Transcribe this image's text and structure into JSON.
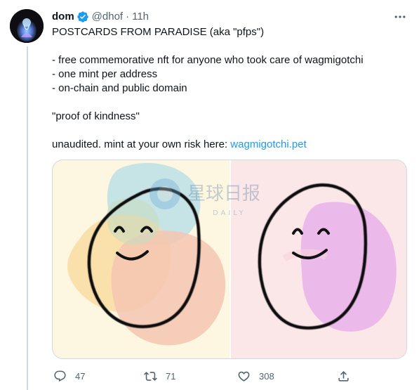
{
  "tweet": {
    "author": {
      "display_name": "dom",
      "handle": "@dhof",
      "verified": true
    },
    "separator": "·",
    "time": "11h",
    "lines": [
      "POSTCARDS FROM PARADISE (aka \"pfps\")",
      "",
      "- free commemorative nft for anyone who took care of wagmigotchi",
      "- one mint per address",
      "- on-chain and public domain",
      "",
      "\"proof of kindness\"",
      ""
    ],
    "last_line_prefix": "unaudited. mint at your own risk here: ",
    "link_text": "wagmigotchi.pet",
    "media": {
      "watermark_cn": "星球日报",
      "watermark_en": "DAILY"
    },
    "actions": {
      "replies": "47",
      "retweets": "71",
      "likes": "308"
    }
  },
  "icons": {
    "more": "more-dots-icon",
    "verified": "verified-badge-icon",
    "reply": "reply-icon",
    "retweet": "retweet-icon",
    "like": "heart-icon",
    "share": "share-icon"
  },
  "colors": {
    "link": "#1d9bf0",
    "secondary_text": "#536471",
    "verified": "#1d9bf0",
    "border": "#cfd9de"
  }
}
